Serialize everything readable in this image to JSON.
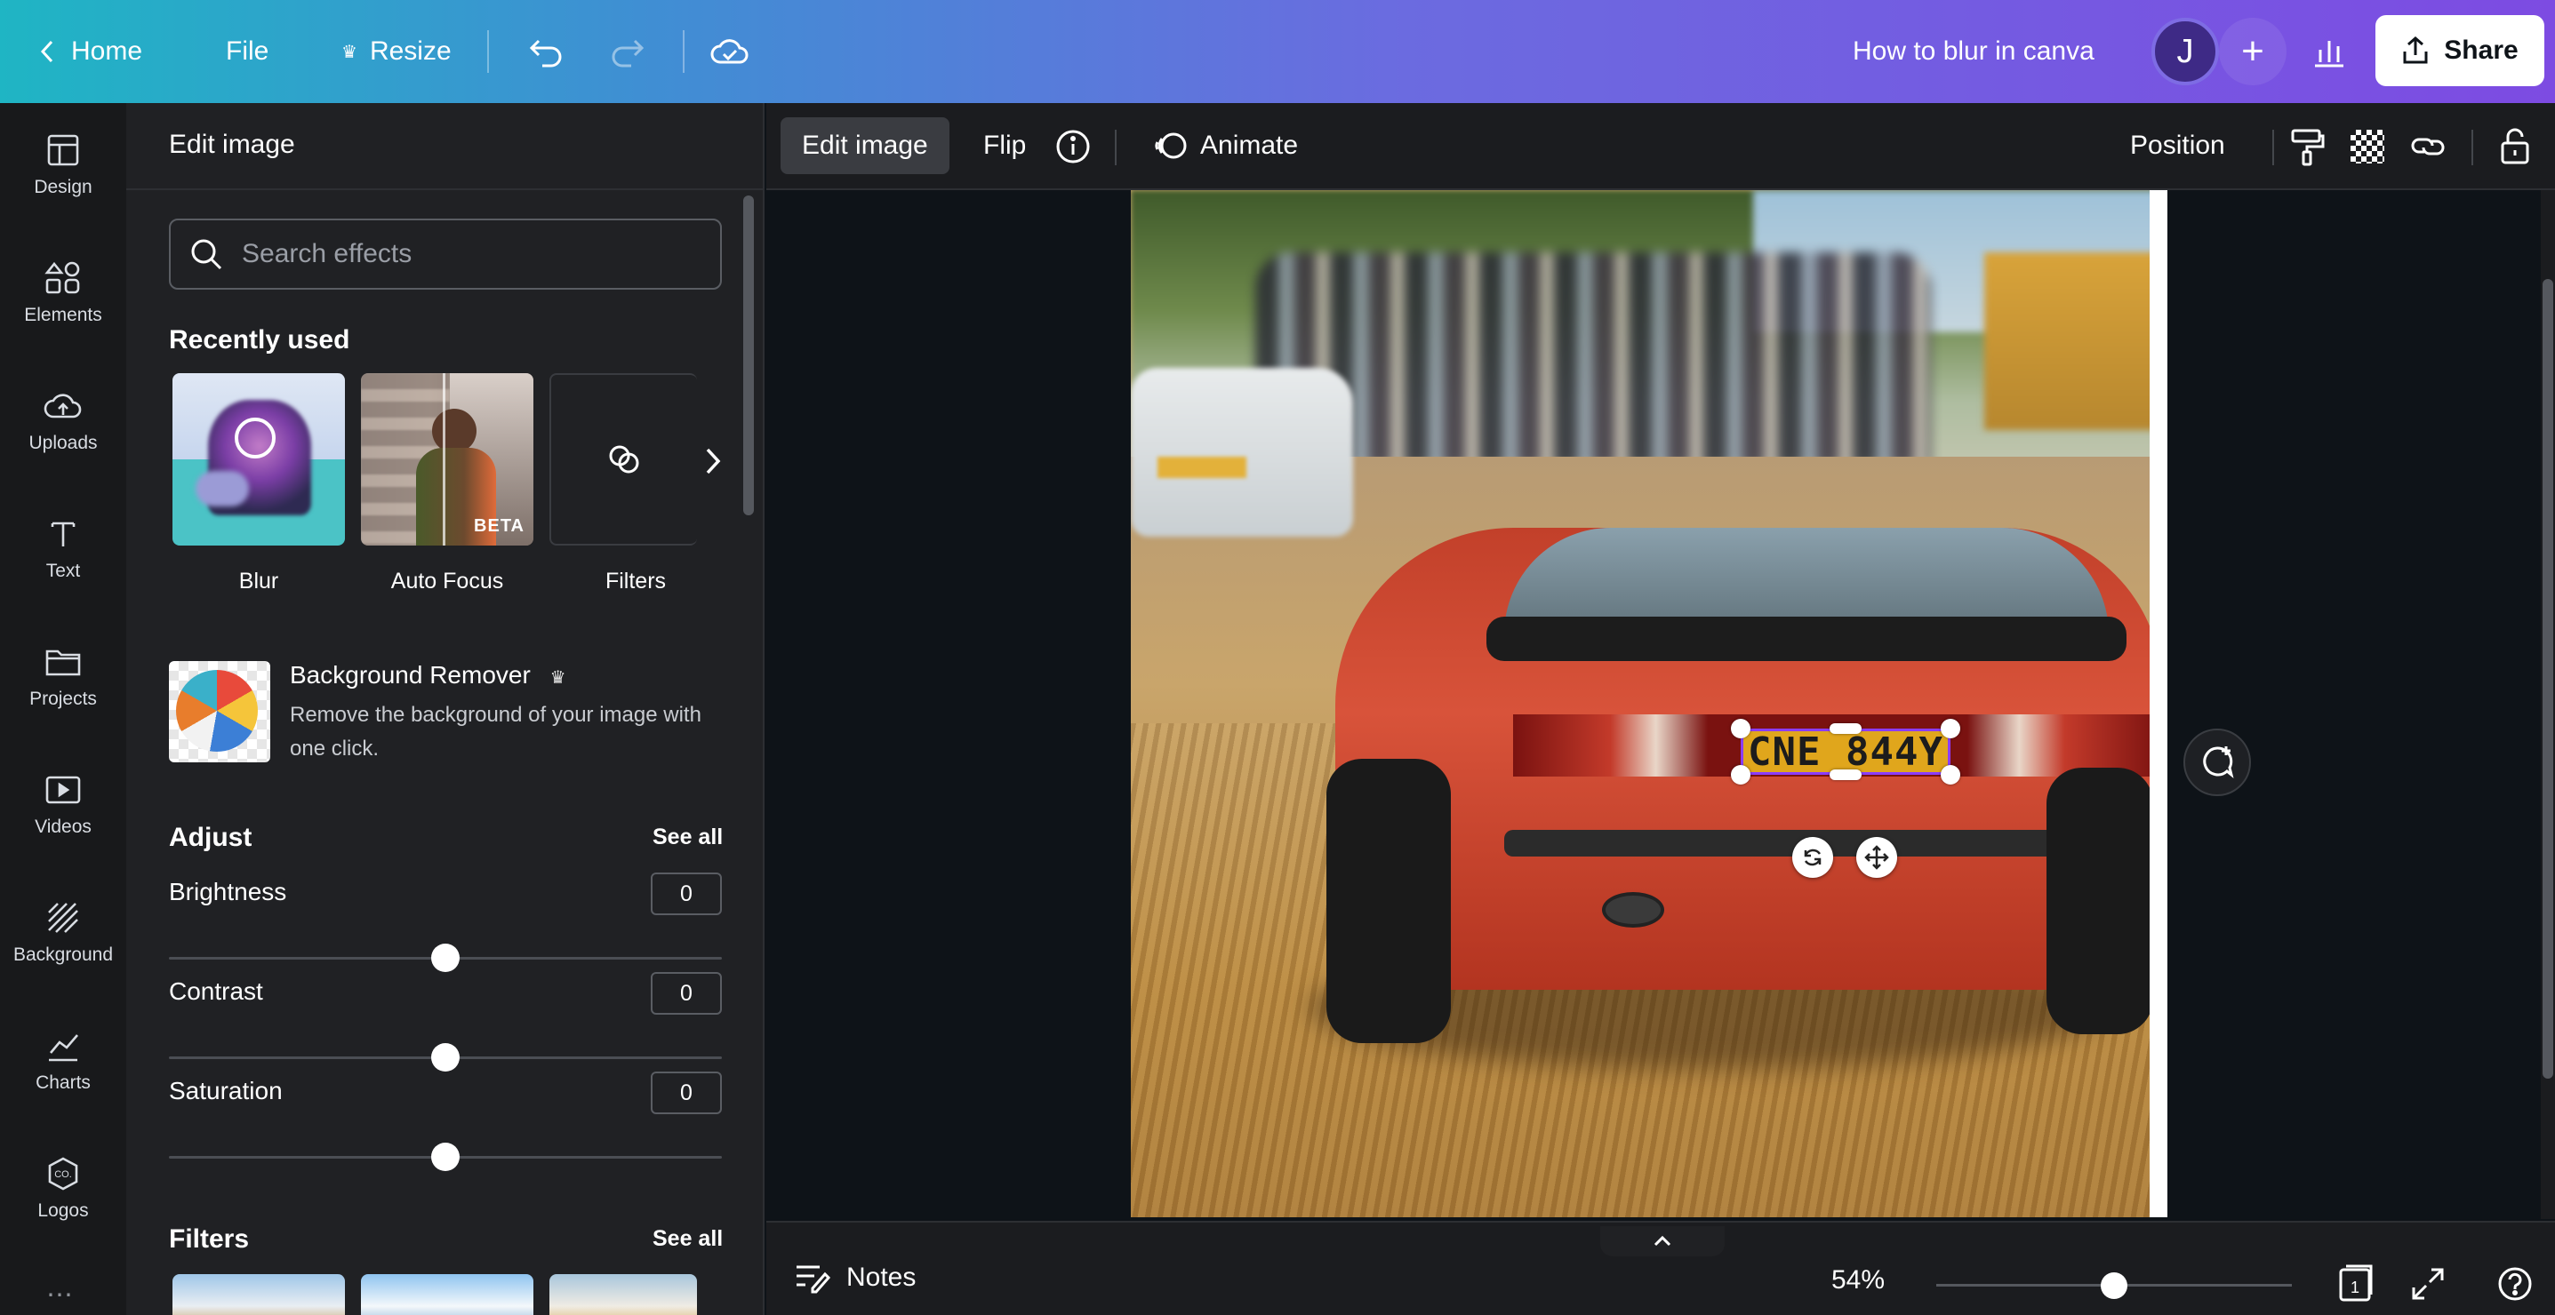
{
  "topbar": {
    "home_label": "Home",
    "file_label": "File",
    "resize_label": "Resize",
    "doc_title": "How to blur in canva",
    "avatar_initial": "J",
    "share_label": "Share"
  },
  "rail": {
    "items": [
      {
        "label": "Design",
        "icon": "design-icon"
      },
      {
        "label": "Elements",
        "icon": "elements-icon"
      },
      {
        "label": "Uploads",
        "icon": "uploads-icon"
      },
      {
        "label": "Text",
        "icon": "text-icon"
      },
      {
        "label": "Projects",
        "icon": "projects-icon"
      },
      {
        "label": "Videos",
        "icon": "videos-icon"
      },
      {
        "label": "Background",
        "icon": "background-icon"
      },
      {
        "label": "Charts",
        "icon": "charts-icon"
      },
      {
        "label": "Logos",
        "icon": "logos-icon"
      }
    ]
  },
  "panel": {
    "title": "Edit image",
    "search_placeholder": "Search effects",
    "recently_used_heading": "Recently used",
    "effects": [
      {
        "label": "Blur"
      },
      {
        "label": "Auto Focus",
        "badge": "BETA"
      },
      {
        "label": "Filters"
      }
    ],
    "bg_remover": {
      "title": "Background Remover",
      "desc": "Remove the background of your image with one click."
    },
    "adjust": {
      "heading": "Adjust",
      "see_all": "See all",
      "sliders": [
        {
          "label": "Brightness",
          "value": "0",
          "level": 0.5
        },
        {
          "label": "Contrast",
          "value": "0",
          "level": 0.5
        },
        {
          "label": "Saturation",
          "value": "0",
          "level": 0.5
        }
      ]
    },
    "filters": {
      "heading": "Filters",
      "see_all": "See all"
    }
  },
  "context_toolbar": {
    "edit_image": "Edit image",
    "flip": "Flip",
    "animate": "Animate",
    "position": "Position"
  },
  "canvas": {
    "plate_text": "CNE 844Y"
  },
  "bottombar": {
    "notes_label": "Notes",
    "zoom": "54%",
    "zoom_level": 0.5,
    "page_number": "1"
  },
  "colors": {
    "accent": "#8b3dff",
    "topbar_start": "#1fb5c4",
    "topbar_end": "#7d4be2",
    "panel_bg": "#202124"
  }
}
